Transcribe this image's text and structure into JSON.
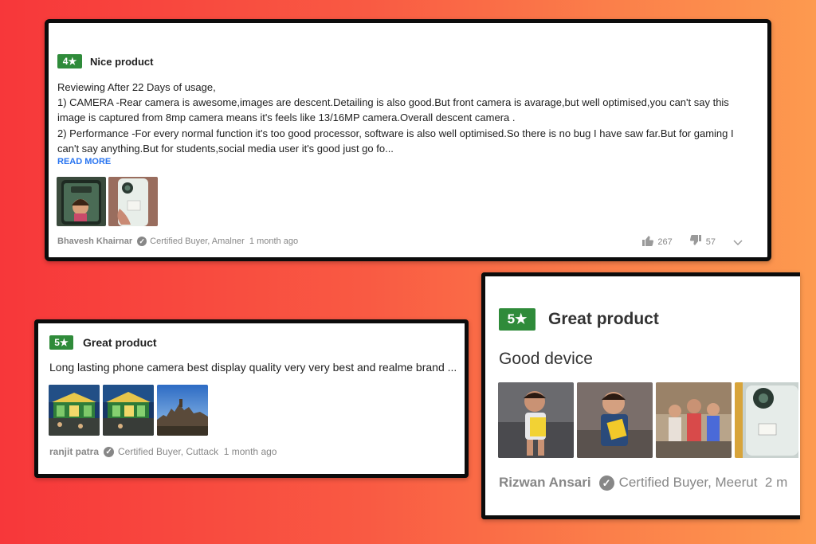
{
  "reviews": [
    {
      "rating": "4★",
      "title": "Nice product",
      "body": [
        "Reviewing After 22 Days of usage,",
        "1) CAMERA -Rear camera is awesome,images are descent.Detailing is also good.But front camera is avarage,but well optimised,you can't say this image is captured from 8mp camera means it's feels like 13/16MP camera.Overall descent camera .",
        "2) Performance -For every normal function it's too good processor, software is also well optimised.So there is no bug I have saw far.But for gaming I can't say anything.But for students,social media user it's good just go fo..."
      ],
      "read_more": "READ MORE",
      "author": "Bhavesh Khairnar",
      "badge": "Certified Buyer, Amalner",
      "time": "1 month ago",
      "likes": "267",
      "dislikes": "57"
    },
    {
      "rating": "5★",
      "title": "Great product",
      "body": "Long lasting phone camera best display quality very very best and realme brand ...",
      "author": "ranjit patra",
      "badge": "Certified Buyer, Cuttack",
      "time": "1 month ago"
    },
    {
      "rating": "5★",
      "title": "Great product",
      "body": "Good device",
      "author": "Rizwan Ansari",
      "badge": "Certified Buyer, Meerut",
      "time": "2 m"
    }
  ],
  "icons": {
    "check": "check-circle-icon",
    "like": "thumbs-up-icon",
    "dislike": "thumbs-down-icon",
    "expand": "chevron-down-icon"
  },
  "colors": {
    "rating_green": "#2f8b3a",
    "link_blue": "#2874f0",
    "meta_gray": "#878787"
  }
}
